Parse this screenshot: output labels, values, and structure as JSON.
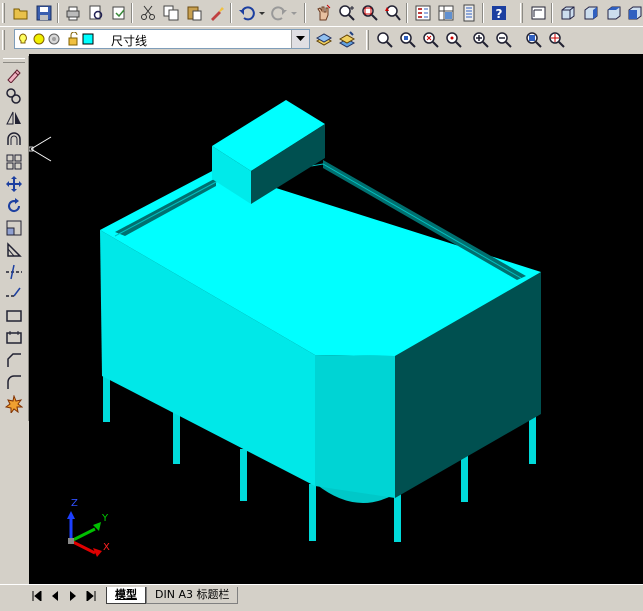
{
  "layers": {
    "current": "尺寸线"
  },
  "tabs": [
    {
      "label": "模型",
      "active": true
    },
    {
      "label": "DIN A3 标题栏",
      "active": false
    }
  ],
  "ucs": {
    "x": "X",
    "y": "Y",
    "z": "Z"
  },
  "colors": {
    "background": "#000000",
    "model_light": "#00ffff",
    "model_mid": "#00e0e0",
    "model_dark": "#004c4c",
    "model_side": "#006666"
  },
  "toolbar_icons": [
    "new-icon",
    "open-icon",
    "save-icon",
    "print-icon",
    "preview-icon",
    "publish-icon",
    "cut-icon",
    "copy-icon",
    "paste-icon",
    "matchprop-icon",
    "undo-icon",
    "redo-icon",
    "pan-icon",
    "zoom-realtime-icon",
    "zoom-window-icon",
    "zoom-previous-icon",
    "properties-icon",
    "designcenter-icon",
    "toolpalette-icon",
    "help-icon",
    "ucs-icon",
    "view-front-icon",
    "view-right-icon",
    "view-iso-icon"
  ],
  "modify_icons": [
    "erase-icon",
    "copy-object-icon",
    "mirror-icon",
    "offset-icon",
    "array-icon",
    "move-icon",
    "rotate-icon",
    "scale-icon",
    "stretch-icon",
    "trim-icon",
    "extend-icon",
    "break-icon",
    "join-icon",
    "chamfer-icon",
    "fillet-icon",
    "explode-icon"
  ]
}
